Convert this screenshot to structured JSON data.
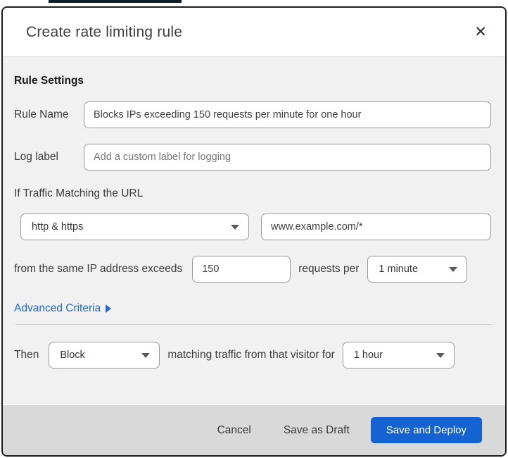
{
  "backdrop": {
    "topbar_color": "#0e1c28"
  },
  "dialog": {
    "title": "Create rate limiting rule",
    "close_icon": "✕"
  },
  "rule_settings": {
    "heading": "Rule Settings",
    "rule_name": {
      "label": "Rule Name",
      "value": "Blocks IPs exceeding 150 requests per minute for one hour"
    },
    "log_label": {
      "label": "Log label",
      "placeholder": "Add a custom label for logging"
    }
  },
  "traffic_match": {
    "intro": "If Traffic Matching the URL",
    "scheme_select": {
      "value": "http & https"
    },
    "url_input": {
      "value": "www.example.com/*"
    },
    "threshold_label": "from the same IP address exceeds",
    "threshold_input": {
      "value": "150"
    },
    "period_label": "requests per",
    "period_select": {
      "value": "1 minute"
    }
  },
  "advanced_criteria": {
    "label": "Advanced Criteria"
  },
  "action": {
    "then_label": "Then",
    "action_select": {
      "value": "Block"
    },
    "duration_label": "matching traffic from that visitor for",
    "duration_select": {
      "value": "1 hour"
    }
  },
  "footer": {
    "cancel_label": "Cancel",
    "save_draft_label": "Save as Draft",
    "save_deploy_label": "Save and Deploy"
  },
  "colors": {
    "primary_button": "#1563d2",
    "link": "#1f68c9",
    "body_background": "#f1f1f2",
    "footer_background": "#d9d9d9"
  }
}
